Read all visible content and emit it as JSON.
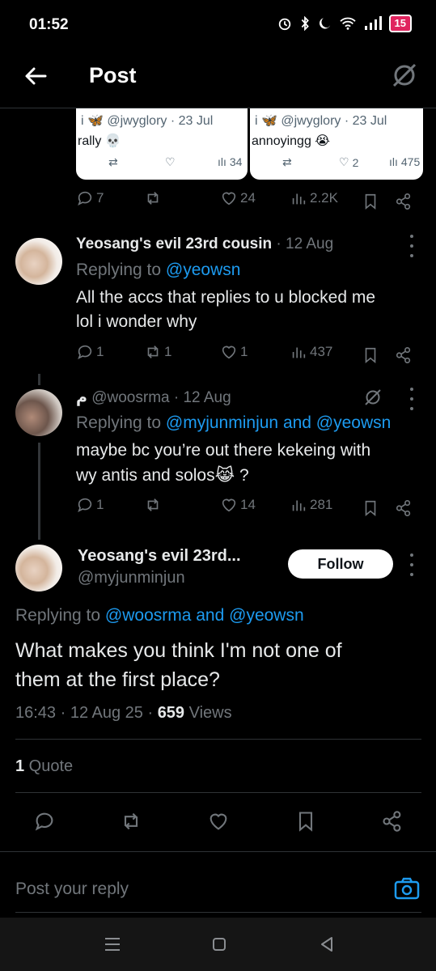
{
  "status": {
    "time": "01:52",
    "battery": "15"
  },
  "header": {
    "title": "Post"
  },
  "quoted_cards": [
    {
      "handle": "@jwyglory · 23 Jul",
      "text": "rally 💀",
      "views": "34"
    },
    {
      "handle": "@jwyglory · 23 Jul",
      "text": "annoyingg 😭",
      "likes": "2",
      "views": "475"
    }
  ],
  "main_stats": {
    "replies": "7",
    "likes": "24",
    "views": "2.2K"
  },
  "reply1": {
    "name": "Yeosang's evil 23rd cousin",
    "date": "· 12 Aug",
    "replying_prefix": "Replying to ",
    "replying_to": "@yeowsn",
    "lines": [
      "All the accs that replies to u blocked me",
      "lol i wonder why"
    ],
    "replies": "1",
    "reposts": "1",
    "likes": "1",
    "views": "437"
  },
  "reply2": {
    "name": "م",
    "handle": "@woosrma",
    "date": "· 12 Aug",
    "replying_prefix": "Replying to ",
    "replying_to": "@myjunminjun and @yeowsn",
    "lines": [
      "maybe bc you’re out there kekeing with",
      "wy antis and solos😹 ?"
    ],
    "replies": "1",
    "likes": "14",
    "views": "281"
  },
  "focus": {
    "name": "Yeosang's evil 23rd...",
    "handle": "@myjunminjun",
    "follow_label": "Follow",
    "replying_prefix": "Replying to ",
    "replying_to": "@woosrma and @yeowsn",
    "lines": [
      "What makes you think I'm not one of",
      "them at the first place?"
    ],
    "timestamp": "16:43 · 12 Aug 25 · ",
    "views_count": "659",
    "views_label": " Views",
    "quote_count": "1",
    "quote_label": " Quote"
  },
  "reply_box": {
    "placeholder": "Post your reply"
  }
}
